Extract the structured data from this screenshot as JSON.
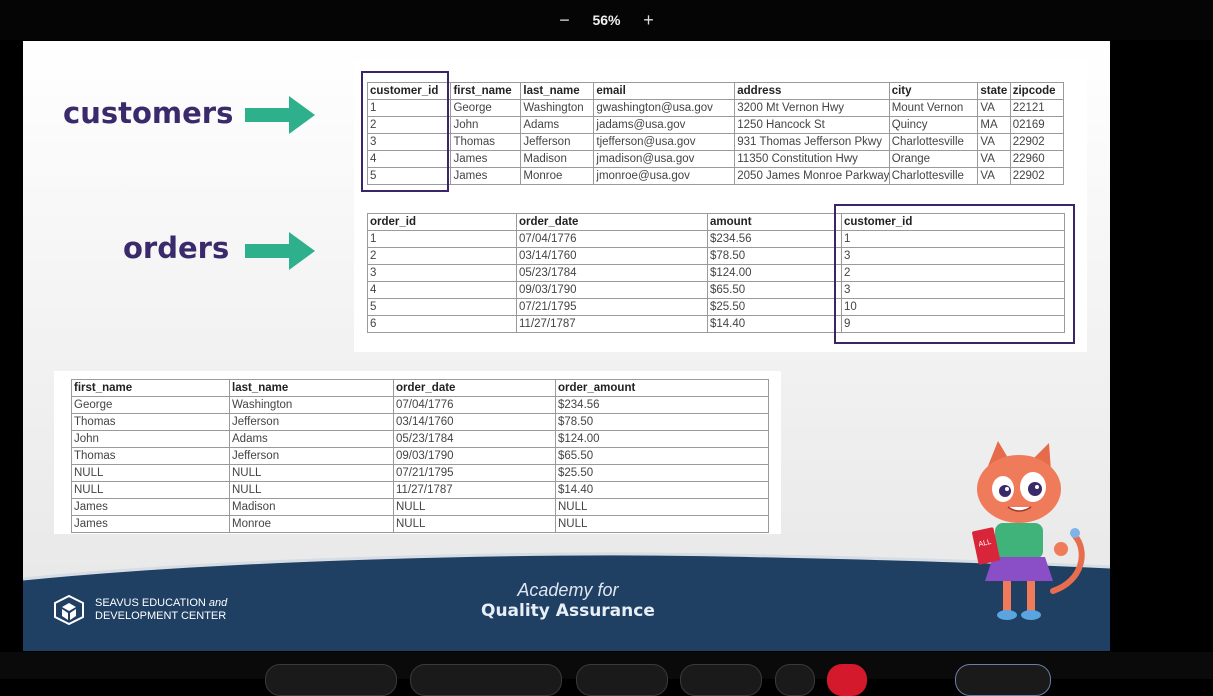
{
  "toolbar": {
    "zoom_out": "−",
    "zoom_value": "56%",
    "zoom_in": "+"
  },
  "slide": {
    "label_customers": "customers",
    "label_orders": "orders",
    "customers_table": {
      "headers": [
        "customer_id",
        "first_name",
        "last_name",
        "email",
        "address",
        "city",
        "state",
        "zipcode"
      ],
      "rows": [
        [
          "1",
          "George",
          "Washington",
          "gwashington@usa.gov",
          "3200 Mt Vernon Hwy",
          "Mount Vernon",
          "VA",
          "22121"
        ],
        [
          "2",
          "John",
          "Adams",
          "jadams@usa.gov",
          "1250 Hancock St",
          "Quincy",
          "MA",
          "02169"
        ],
        [
          "3",
          "Thomas",
          "Jefferson",
          "tjefferson@usa.gov",
          "931 Thomas Jefferson Pkwy",
          "Charlottesville",
          "VA",
          "22902"
        ],
        [
          "4",
          "James",
          "Madison",
          "jmadison@usa.gov",
          "11350 Constitution Hwy",
          "Orange",
          "VA",
          "22960"
        ],
        [
          "5",
          "James",
          "Monroe",
          "jmonroe@usa.gov",
          "2050 James Monroe Parkway",
          "Charlottesville",
          "VA",
          "22902"
        ]
      ]
    },
    "orders_table": {
      "headers": [
        "order_id",
        "order_date",
        "amount",
        "customer_id"
      ],
      "rows": [
        [
          "1",
          "07/04/1776",
          "$234.56",
          "1"
        ],
        [
          "2",
          "03/14/1760",
          "$78.50",
          "3"
        ],
        [
          "3",
          "05/23/1784",
          "$124.00",
          "2"
        ],
        [
          "4",
          "09/03/1790",
          "$65.50",
          "3"
        ],
        [
          "5",
          "07/21/1795",
          "$25.50",
          "10"
        ],
        [
          "6",
          "11/27/1787",
          "$14.40",
          "9"
        ]
      ]
    },
    "result_table": {
      "headers": [
        "first_name",
        "last_name",
        "order_date",
        "order_amount"
      ],
      "rows": [
        [
          "George",
          "Washington",
          "07/04/1776",
          "$234.56"
        ],
        [
          "Thomas",
          "Jefferson",
          "03/14/1760",
          "$78.50"
        ],
        [
          "John",
          "Adams",
          "05/23/1784",
          "$124.00"
        ],
        [
          "Thomas",
          "Jefferson",
          "09/03/1790",
          "$65.50"
        ],
        [
          "NULL",
          "NULL",
          "07/21/1795",
          "$25.50"
        ],
        [
          "NULL",
          "NULL",
          "11/27/1787",
          "$14.40"
        ],
        [
          "James",
          "Madison",
          "NULL",
          "NULL"
        ],
        [
          "James",
          "Monroe",
          "NULL",
          "NULL"
        ]
      ]
    },
    "brand_line1": "SEAVUS EDUCATION",
    "brand_and": "and",
    "brand_line2": "DEVELOPMENT CENTER",
    "academy_line1": "Academy for",
    "academy_line2": "Quality Assurance",
    "mascot_book_text": "ALL"
  },
  "colors": {
    "label_purple": "#3b2a6b",
    "arrow_teal": "#2fb08c",
    "highlight_border": "#3c2468",
    "footer_blue": "#1f3f63"
  }
}
